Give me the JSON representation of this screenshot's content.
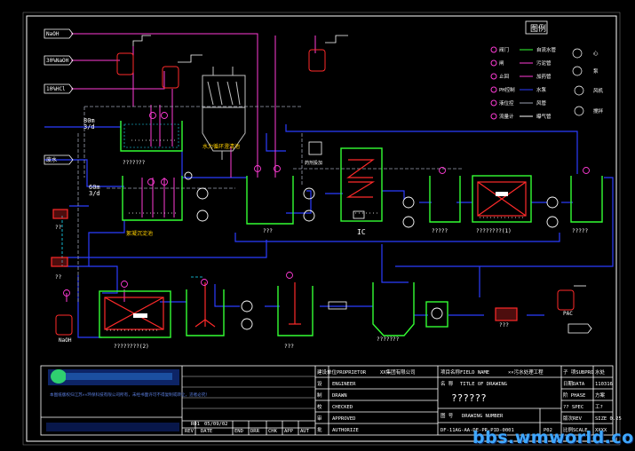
{
  "feeds": {
    "in1": "NaOH",
    "in2": "30%NaOH",
    "in3": "10%HCl",
    "in4": "废水"
  },
  "flow": {
    "top": "80m\n3/d",
    "mid": "60m\n3/d"
  },
  "labels": {
    "clarifier": "水力循环澄清池",
    "ic": "IC",
    "tank_upper": "???????",
    "tank_lower": "絮凝沉淀池",
    "box_center": "???",
    "tank_a": "?????",
    "tank_b": "????????(1)",
    "tank_c": "?????",
    "tank_d": "????????(2)",
    "tank_e": "???",
    "tank_f": "???????",
    "pac": "PAC",
    "naoh_bottom": "NaOH",
    "left_pump1": "??",
    "left_pump2": "??",
    "small_box": "药剂投加"
  },
  "legend": {
    "title": "图例",
    "items": [
      {
        "sym": "阀门",
        "desc": "自流水管"
      },
      {
        "sym": "闸",
        "desc": "污泥管"
      },
      {
        "sym": "止回",
        "desc": "加药管"
      },
      {
        "sym": "PH控制",
        "desc": "水泵"
      },
      {
        "sym": "液位控",
        "desc": "风管"
      },
      {
        "sym": "流量计",
        "desc": "曝气管"
      }
    ],
    "right": [
      "心",
      "泵",
      "风机",
      "搅拌"
    ]
  },
  "title_block": {
    "company_note": "本图纸版权归江苏××环保科技有限公司所有，未经书面许可不得复制或转让，违者必究！",
    "col_headers": [
      "REV",
      "DATE",
      "",
      "END",
      "DRR",
      "CHK",
      "APP",
      "AUT"
    ],
    "rev": "R01",
    "date": "05/09/02",
    "proprietor_label": "建设单位PROPRIETOR",
    "proprietor": "XX集团有限公司",
    "engineer": "ENGINEER",
    "drawn": "DRAWN",
    "checked": "CHECKED",
    "approved": "APPROVED",
    "authorize": "AUTHORIZE",
    "r1": "设",
    "r2": "制",
    "r3": "校",
    "r4": "审",
    "r5": "批",
    "project_label": "项目名称FIELD NAME",
    "project": "××污水处理工程",
    "drawing_title_label": "TITLE OF DRAWING",
    "name_label": "名 称",
    "drawing_title": "??????",
    "number_label": "DRAWING NUMBER",
    "num_label_cn": "图 号",
    "drawing_number": "DF-11AG-AA-DE-PR-PID-0001",
    "rev_value": "P02",
    "sheet_rows": [
      [
        "子 项SUBPRO",
        "水处"
      ],
      [
        "日期DATA",
        "110316"
      ],
      [
        "阶 PHASE",
        "方案"
      ],
      [
        "?? SPEC",
        "工?"
      ],
      [
        "版次REV",
        "SIZE  0.25"
      ],
      [
        "比例SCALE",
        "XXXX"
      ]
    ]
  },
  "watermark": "bbs.wmworld.com"
}
